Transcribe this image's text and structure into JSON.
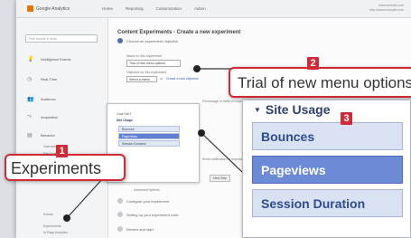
{
  "app": {
    "name": "Google Analytics"
  },
  "topbar": {
    "tabs": [
      "Home",
      "Reporting",
      "Customization",
      "Admin"
    ],
    "account_line1": "www.website.com",
    "account_line2": "http://www.example.com"
  },
  "sidebar": {
    "search_placeholder": "Find reports & more",
    "items": [
      {
        "label": "Intelligence Events",
        "icon": "lightbulb-icon",
        "glyph": "💡"
      },
      {
        "label": "Real-Time",
        "icon": "clock-icon",
        "glyph": "◷"
      },
      {
        "label": "Audience",
        "icon": "people-icon",
        "glyph": "👥"
      },
      {
        "label": "Acquisition",
        "icon": "acquisition-icon",
        "glyph": "⤳"
      },
      {
        "label": "Behavior",
        "icon": "behavior-icon",
        "glyph": "▤"
      }
    ],
    "sub_items": [
      "Overview",
      "Site Content",
      "Events",
      "Experiments",
      "In-Page Analytics"
    ]
  },
  "main": {
    "title": "Content Experiments - Create a new experiment",
    "step1": "Choose an experiment objective",
    "name_label": "Name for this experiment",
    "name_value": "Trial of new menu options",
    "objective_label": "Objective for this experiment",
    "objective_select": "Select a metric",
    "or_text": "or",
    "create_objective": "Create a new objective",
    "mini_header_goal": "Goal Set 1",
    "mini_header": "Site Usage",
    "mini_options": [
      "Bounces",
      "Pageviews",
      "Session Duration"
    ],
    "percent_label": "Percentage of traffic to experiment",
    "email_label": "Email notification for important changes",
    "step2": "Configure your experiment",
    "step3": "Setting up your experiment code",
    "step4": "Review and start",
    "next_button": "Next Step",
    "advanced": "Advanced Options"
  },
  "callouts": [
    {
      "number": "1",
      "text": "Experiments"
    },
    {
      "number": "2",
      "text": "Trial of new menu options"
    },
    {
      "number": "3",
      "header": "Site Usage",
      "options": [
        "Bounces",
        "Pageviews",
        "Session Duration"
      ],
      "selected": "Pageviews"
    }
  ],
  "colors": {
    "callout_red": "#d02a36",
    "highlight_blue": "#6d8ad6",
    "option_blue": "#d9e2f3"
  }
}
